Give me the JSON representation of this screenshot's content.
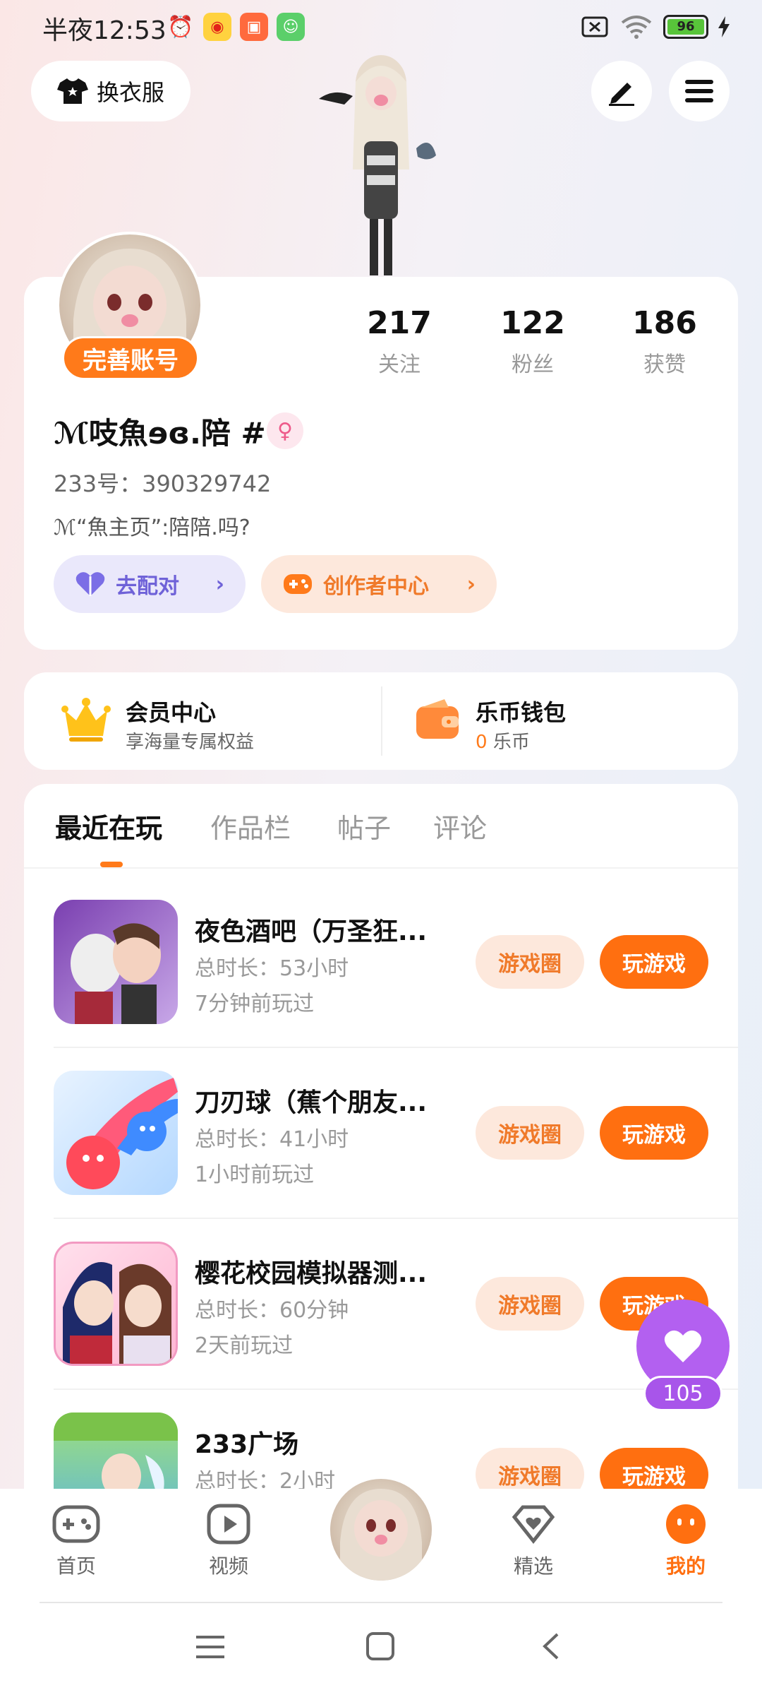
{
  "status_bar": {
    "time": "半夜12:53",
    "battery": "96"
  },
  "top": {
    "wardrobe_label": "换衣服"
  },
  "profile": {
    "complete_account": "完善账号",
    "stats": [
      {
        "value": "217",
        "label": "关注"
      },
      {
        "value": "122",
        "label": "粉丝"
      },
      {
        "value": "186",
        "label": "获赞"
      }
    ],
    "nickname": "ℳ吱魚ɘɞ.陪 #",
    "gender_symbol": "♀",
    "uid": "233号：390329742",
    "bio": "ℳ“魚主页”:陪陪.吗?",
    "match_label": "去配对",
    "creator_label": "创作者中心"
  },
  "vip": {
    "title": "会员中心",
    "subtitle": "享海量专属权益"
  },
  "wallet": {
    "title": "乐币钱包",
    "amount": "0",
    "unit": "乐币"
  },
  "tabs": [
    {
      "label": "最近在玩",
      "active": true
    },
    {
      "label": "作品栏",
      "active": false
    },
    {
      "label": "帖子",
      "active": false
    },
    {
      "label": "评论",
      "active": false
    }
  ],
  "games": [
    {
      "title": "夜色酒吧（万圣狂...",
      "duration": "总时长：53小时",
      "last_played": "7分钟前玩过"
    },
    {
      "title": "刀刃球（蕉个朋友...",
      "duration": "总时长：41小时",
      "last_played": "1小时前玩过"
    },
    {
      "title": "樱花校园模拟器测...",
      "duration": "总时长：60分钟",
      "last_played": "2天前玩过"
    },
    {
      "title": "233广场",
      "duration": "总时长：2小时",
      "last_played": ""
    }
  ],
  "game_buttons": {
    "circle": "游戏圈",
    "play": "玩游戏"
  },
  "like_count": "105",
  "bottom_nav": [
    {
      "label": "首页"
    },
    {
      "label": "视频"
    },
    {
      "label": "精选"
    },
    {
      "label": "我的"
    }
  ],
  "colors": {
    "accent": "#ff6f10",
    "accent_soft": "#fde8dc",
    "match_purple": "#6f62d8",
    "like_purple": "#b360f0"
  }
}
